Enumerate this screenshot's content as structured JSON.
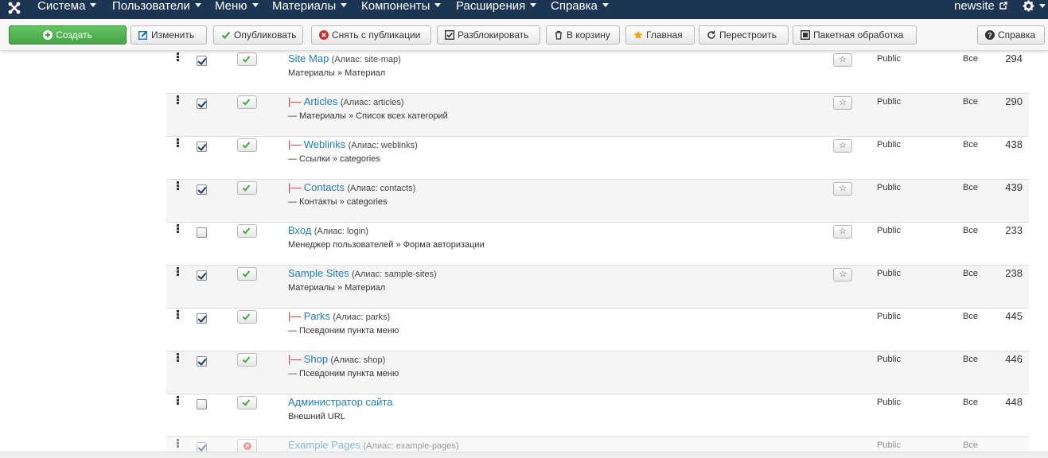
{
  "navbar": {
    "menus": [
      "Система",
      "Пользователи",
      "Меню",
      "Материалы",
      "Компоненты",
      "Расширения",
      "Справка"
    ],
    "site_name": "newsite"
  },
  "toolbar": {
    "create": "Создать",
    "edit": "Изменить",
    "publish": "Опубликовать",
    "unpublish": "Снять с публикации",
    "checkin": "Разблокировать",
    "trash": "В корзину",
    "home": "Главная",
    "rebuild": "Перестроить",
    "batch": "Пакетная обработка",
    "help": "Справка"
  },
  "items": [
    {
      "prefix": "",
      "title": "Site Map",
      "alias": "(Алиас: site-map)",
      "type": "Материалы » Материал",
      "checked": true,
      "published": true,
      "home_star": true,
      "access": "Public",
      "language": "Все",
      "id": "294"
    },
    {
      "prefix": "|—",
      "title": "Articles",
      "alias": "(Алиас: articles)",
      "type": "— Материалы » Список всех категорий",
      "checked": true,
      "published": true,
      "home_star": true,
      "access": "Public",
      "language": "Все",
      "id": "290"
    },
    {
      "prefix": "|—",
      "title": "Weblinks",
      "alias": "(Алиас: weblinks)",
      "type": "— Ссылки » categories",
      "checked": true,
      "published": true,
      "home_star": true,
      "access": "Public",
      "language": "Все",
      "id": "438"
    },
    {
      "prefix": "|—",
      "title": "Contacts",
      "alias": "(Алиас: contacts)",
      "type": "— Контакты » categories",
      "checked": true,
      "published": true,
      "home_star": true,
      "access": "Public",
      "language": "Все",
      "id": "439"
    },
    {
      "prefix": "",
      "title": "Вход",
      "alias": "(Алиас: login)",
      "type": "Менеджер пользователей » Форма авторизации",
      "checked": false,
      "published": true,
      "home_star": true,
      "access": "Public",
      "language": "Все",
      "id": "233"
    },
    {
      "prefix": "",
      "title": "Sample Sites",
      "alias": "(Алиас: sample-sites)",
      "type": "Материалы » Материал",
      "checked": true,
      "published": true,
      "home_star": true,
      "access": "Public",
      "language": "Все",
      "id": "238"
    },
    {
      "prefix": "|—",
      "title": "Parks",
      "alias": "(Алиас: parks)",
      "type": "— Псевдоним пункта меню",
      "checked": true,
      "published": true,
      "home_star": false,
      "access": "Public",
      "language": "Все",
      "id": "445"
    },
    {
      "prefix": "|—",
      "title": "Shop",
      "alias": "(Алиас: shop)",
      "type": "— Псевдоним пункта меню",
      "checked": true,
      "published": true,
      "home_star": false,
      "access": "Public",
      "language": "Все",
      "id": "446"
    },
    {
      "prefix": "",
      "title": "Администратор сайта",
      "alias": "",
      "type": "Внешний URL",
      "checked": false,
      "published": true,
      "home_star": false,
      "access": "Public",
      "language": "Все",
      "id": "448"
    },
    {
      "prefix": "",
      "title": "Example Pages",
      "alias": "(Алиас: example-pages)",
      "type": "",
      "checked": true,
      "published": false,
      "home_star": false,
      "access": "Public",
      "language": "Все",
      "id": ""
    }
  ]
}
